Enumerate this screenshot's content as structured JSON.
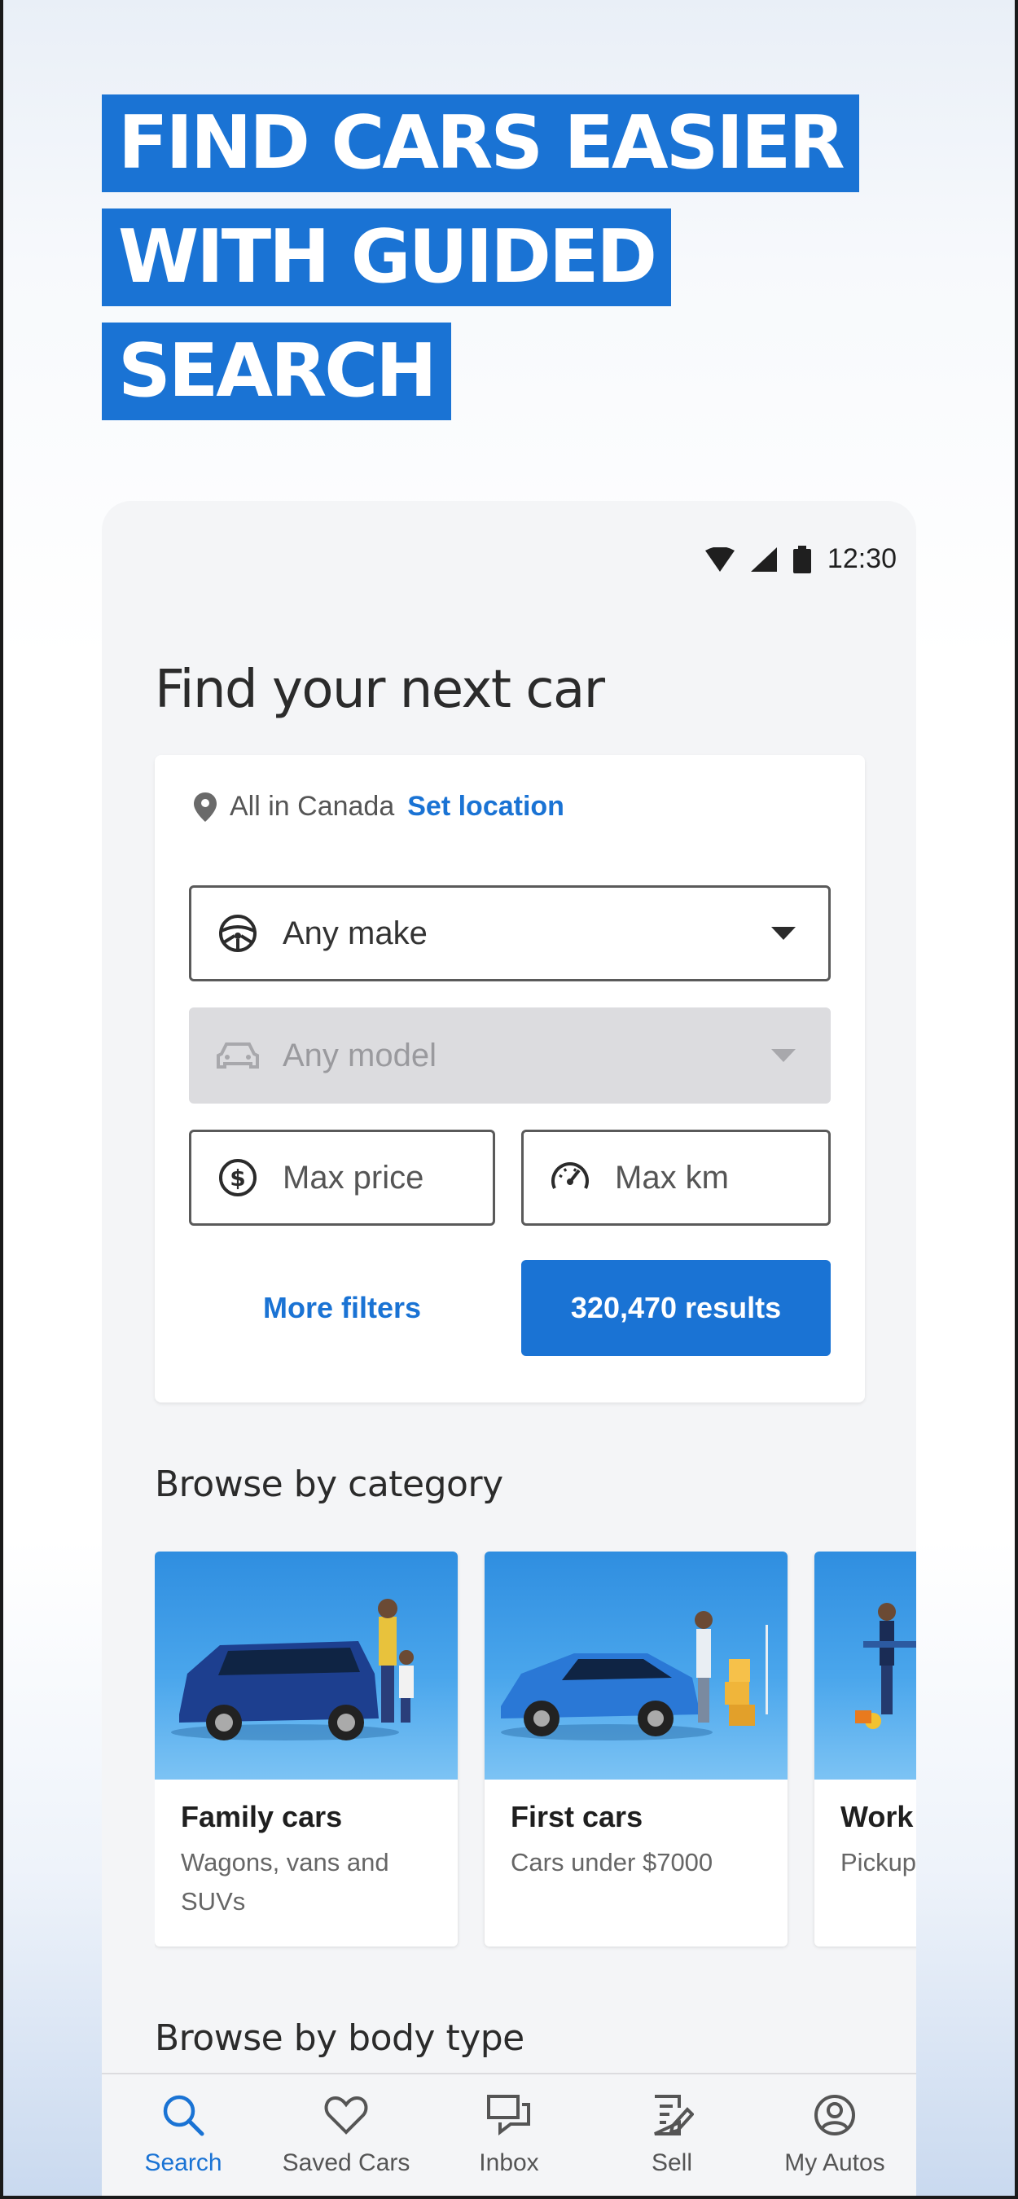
{
  "headline": {
    "lines": [
      "FIND CARS EASIER",
      "WITH GUIDED",
      "SEARCH"
    ]
  },
  "status_bar": {
    "time": "12:30",
    "icons": [
      "wifi-icon",
      "signal-icon",
      "battery-icon"
    ]
  },
  "page": {
    "title": "Find your next car"
  },
  "search": {
    "location_text": "All in Canada",
    "set_location_label": "Set location",
    "make_value": "Any make",
    "model_value": "Any model",
    "max_price_placeholder": "Max price",
    "max_km_placeholder": "Max km",
    "more_filters_label": "More filters",
    "results_label": "320,470 results"
  },
  "browse_category": {
    "title": "Browse by category",
    "items": [
      {
        "title": "Family cars",
        "subtitle": "Wagons, vans and SUVs"
      },
      {
        "title": "First cars",
        "subtitle": "Cars under $7000"
      },
      {
        "title": "Work",
        "subtitle": "Pickup"
      }
    ]
  },
  "browse_body": {
    "title": "Browse by body type"
  },
  "nav": {
    "items": [
      {
        "label": "Search",
        "icon": "search-icon",
        "active": true
      },
      {
        "label": "Saved Cars",
        "icon": "heart-icon"
      },
      {
        "label": "Inbox",
        "icon": "chat-icon"
      },
      {
        "label": "Sell",
        "icon": "edit-document-icon"
      },
      {
        "label": "My Autos",
        "icon": "account-icon"
      }
    ]
  },
  "colors": {
    "accent": "#1a73d4",
    "phone_bg": "#f4f5f7",
    "disabled": "#dcdcdf"
  }
}
